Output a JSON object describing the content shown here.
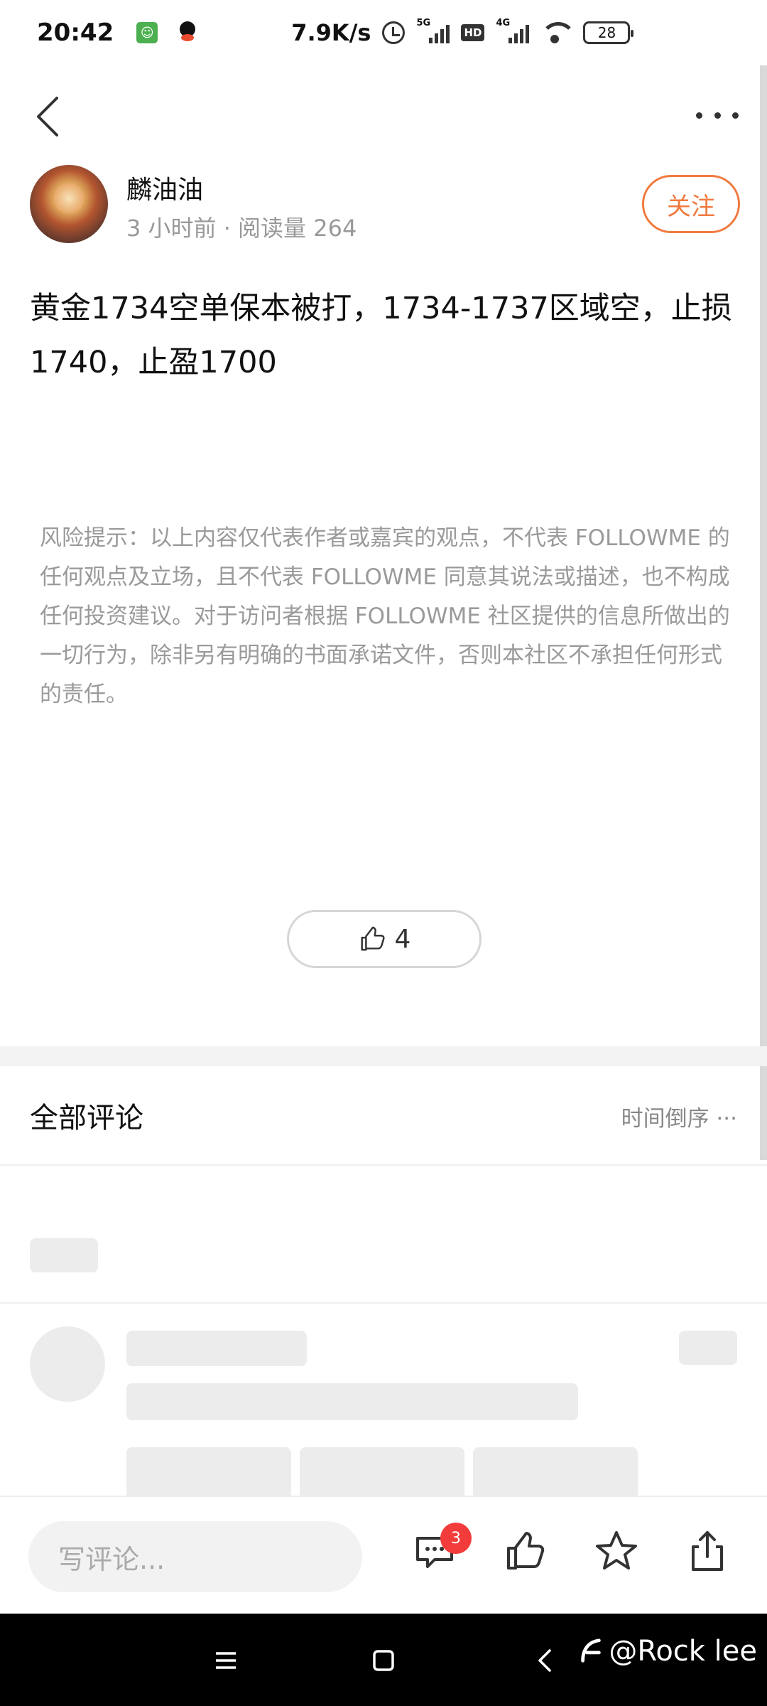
{
  "status_bar": {
    "time": "20:42",
    "network_speed": "7.9K/s",
    "signal_1_tag": "5G",
    "signal_2_tag": "4G",
    "hd_label": "HD",
    "battery": "28"
  },
  "post": {
    "author_name": "麟油油",
    "meta": "3 小时前 · 阅读量 264",
    "follow_label": "关注",
    "text": "黄金1734空单保本被打，1734-1737区域空，止损1740，止盈1700",
    "disclaimer": "风险提示：以上内容仅代表作者或嘉宾的观点，不代表 FOLLOWME 的任何观点及立场，且不代表 FOLLOWME 同意其说法或描述，也不构成任何投资建议。对于访问者根据 FOLLOWME 社区提供的信息所做出的一切行为，除非另有明确的书面承诺文件，否则本社区不承担任何形式的责任。",
    "like_count": "4"
  },
  "comments": {
    "title": "全部评论",
    "sort_label": "时间倒序 ···"
  },
  "bottom_bar": {
    "input_placeholder": "写评论...",
    "comment_badge": "3"
  },
  "watermark": {
    "text": "@Rock lee"
  },
  "colors": {
    "accent": "#f07a3f",
    "badge": "#f23c3c",
    "skeleton": "#ececec"
  }
}
